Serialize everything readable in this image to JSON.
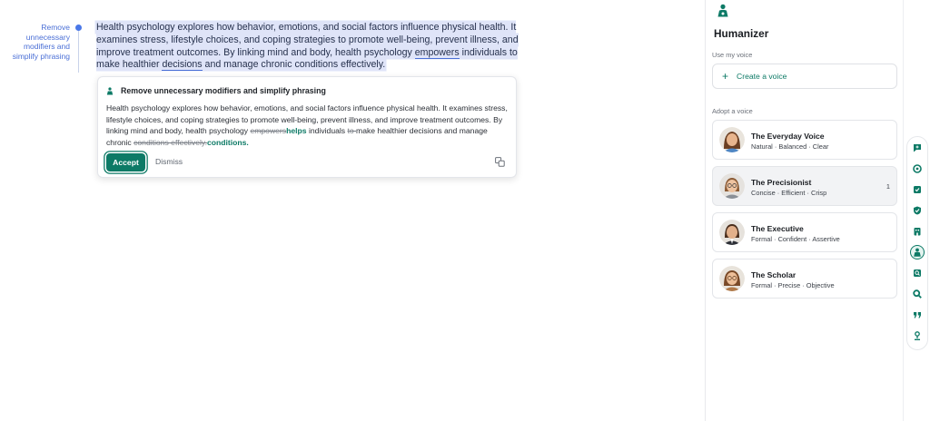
{
  "editor": {
    "margin_note": "Remove unnecessary modifiers and simplify phrasing",
    "paragraph": {
      "part1": "Health psychology explores how behavior, emotions, and social factors influence physical health. It examines stress, lifestyle choices, and coping strategies to promote well-being, prevent illness, and improve treatment outcomes. By linking mind and body, health psychology ",
      "word_empowers": "empowers",
      "part2": " individuals to make healthier ",
      "word_decisions": "decisions",
      "part3": " and manage chronic conditions effectively."
    }
  },
  "suggestion": {
    "title": "Remove unnecessary modifiers and simplify phrasing",
    "body_part1": "Health psychology explores how behavior, emotions, and social factors influence physical health. It examines stress, lifestyle choices, and coping strategies to promote well-being, prevent illness, and improve treatment outcomes. By linking mind and body, health psychology ",
    "del1": "empowers",
    "ins1": "helps",
    "body_part2": " individuals ",
    "del2": "to ",
    "body_part3": "make healthier decisions and manage chronic ",
    "del3": "conditions effectively.",
    "ins2": "conditions.",
    "accept_label": "Accept",
    "dismiss_label": "Dismiss"
  },
  "panel": {
    "title": "Humanizer",
    "use_my_voice_label": "Use my voice",
    "create_voice_label": "Create a voice",
    "adopt_voice_label": "Adopt a voice",
    "voices": [
      {
        "name": "The Everyday Voice",
        "tags": "Natural · Balanced · Clear",
        "count": ""
      },
      {
        "name": "The Precisionist",
        "tags": "Concise · Efficient · Crisp",
        "count": "1"
      },
      {
        "name": "The Executive",
        "tags": "Formal · Confident · Assertive",
        "count": ""
      },
      {
        "name": "The Scholar",
        "tags": "Formal · Precise · Objective",
        "count": ""
      }
    ]
  },
  "rail": {
    "icons": [
      "chat-plus-icon",
      "rewrite-icon",
      "ai-detect-icon",
      "check-shield-icon",
      "building-icon",
      "humanizer-icon",
      "plagiarism-icon",
      "search-icon",
      "quote-icon",
      "person-pin-icon"
    ],
    "active": "humanizer-icon"
  },
  "colors": {
    "accent": "#0d7a66",
    "highlight": "#dfe4f8",
    "link": "#4a6fd6"
  }
}
